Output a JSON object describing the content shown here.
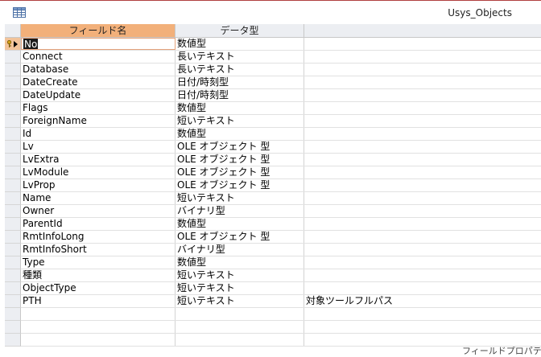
{
  "window": {
    "title": "Usys_Objects",
    "icon": "table-icon"
  },
  "headers": [
    "フィールド名",
    "データ型",
    ""
  ],
  "rows": [
    {
      "field": "No",
      "type": "数値型",
      "desc": ""
    },
    {
      "field": "Connect",
      "type": "長いテキスト",
      "desc": ""
    },
    {
      "field": "Database",
      "type": "長いテキスト",
      "desc": ""
    },
    {
      "field": "DateCreate",
      "type": "日付/時刻型",
      "desc": ""
    },
    {
      "field": "DateUpdate",
      "type": "日付/時刻型",
      "desc": ""
    },
    {
      "field": "Flags",
      "type": "数値型",
      "desc": ""
    },
    {
      "field": "ForeignName",
      "type": "短いテキスト",
      "desc": ""
    },
    {
      "field": "Id",
      "type": "数値型",
      "desc": ""
    },
    {
      "field": "Lv",
      "type": "OLE オブジェクト 型",
      "desc": ""
    },
    {
      "field": "LvExtra",
      "type": "OLE オブジェクト 型",
      "desc": ""
    },
    {
      "field": "LvModule",
      "type": "OLE オブジェクト 型",
      "desc": ""
    },
    {
      "field": "LvProp",
      "type": "OLE オブジェクト 型",
      "desc": ""
    },
    {
      "field": "Name",
      "type": "短いテキスト",
      "desc": ""
    },
    {
      "field": "Owner",
      "type": "バイナリ型",
      "desc": ""
    },
    {
      "field": "ParentId",
      "type": "数値型",
      "desc": ""
    },
    {
      "field": "RmtInfoLong",
      "type": "OLE オブジェクト 型",
      "desc": ""
    },
    {
      "field": "RmtInfoShort",
      "type": "バイナリ型",
      "desc": ""
    },
    {
      "field": "Type",
      "type": "数値型",
      "desc": ""
    },
    {
      "field": "種類",
      "type": "短いテキスト",
      "desc": ""
    },
    {
      "field": "ObjectType",
      "type": "短いテキスト",
      "desc": ""
    },
    {
      "field": "PTH",
      "type": "短いテキスト",
      "desc": "対象ツールフルパス"
    }
  ],
  "empty_rows": 3,
  "current_row": 0,
  "row_icons": [
    "primary-key-icon",
    "current-row-arrow-icon"
  ],
  "footer_partial_text": "フィールドプロパティ",
  "colors": {
    "header_selected": "#f2b07a",
    "header_bg": "#eceef2",
    "title_border": "#b04040"
  }
}
